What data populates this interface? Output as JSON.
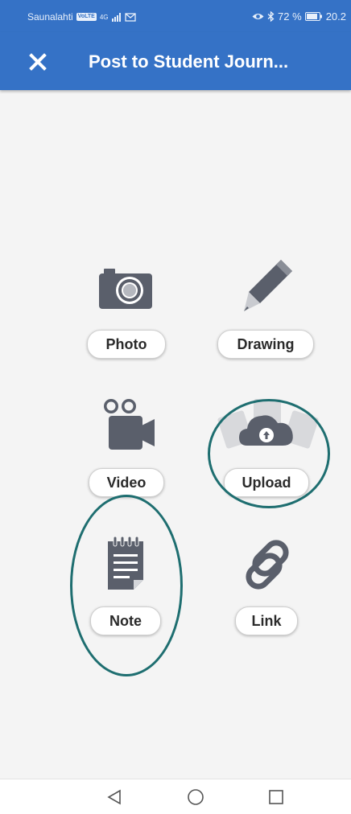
{
  "status_bar": {
    "carrier": "Saunalahti",
    "carrier_badge": "VoLTE",
    "network": "4G",
    "extra_icon": "message-icon",
    "battery_percent": "72 %",
    "time": "20.2"
  },
  "header": {
    "close_icon": "close-icon",
    "title": "Post to Student Journ..."
  },
  "options": [
    {
      "label": "Photo",
      "icon": "camera-icon"
    },
    {
      "label": "Drawing",
      "icon": "pencil-icon"
    },
    {
      "label": "Video",
      "icon": "video-camera-icon"
    },
    {
      "label": "Upload",
      "icon": "cloud-upload-icon"
    },
    {
      "label": "Note",
      "icon": "notepad-icon"
    },
    {
      "label": "Link",
      "icon": "link-icon"
    }
  ],
  "colors": {
    "app_bar": "#3572c6",
    "icon_gray": "#5a5f6b",
    "highlight_ring": "#1e6e70"
  },
  "nav_bar": {
    "back_icon": "back-triangle-icon",
    "home_icon": "home-circle-icon",
    "recents_icon": "recents-square-icon"
  }
}
